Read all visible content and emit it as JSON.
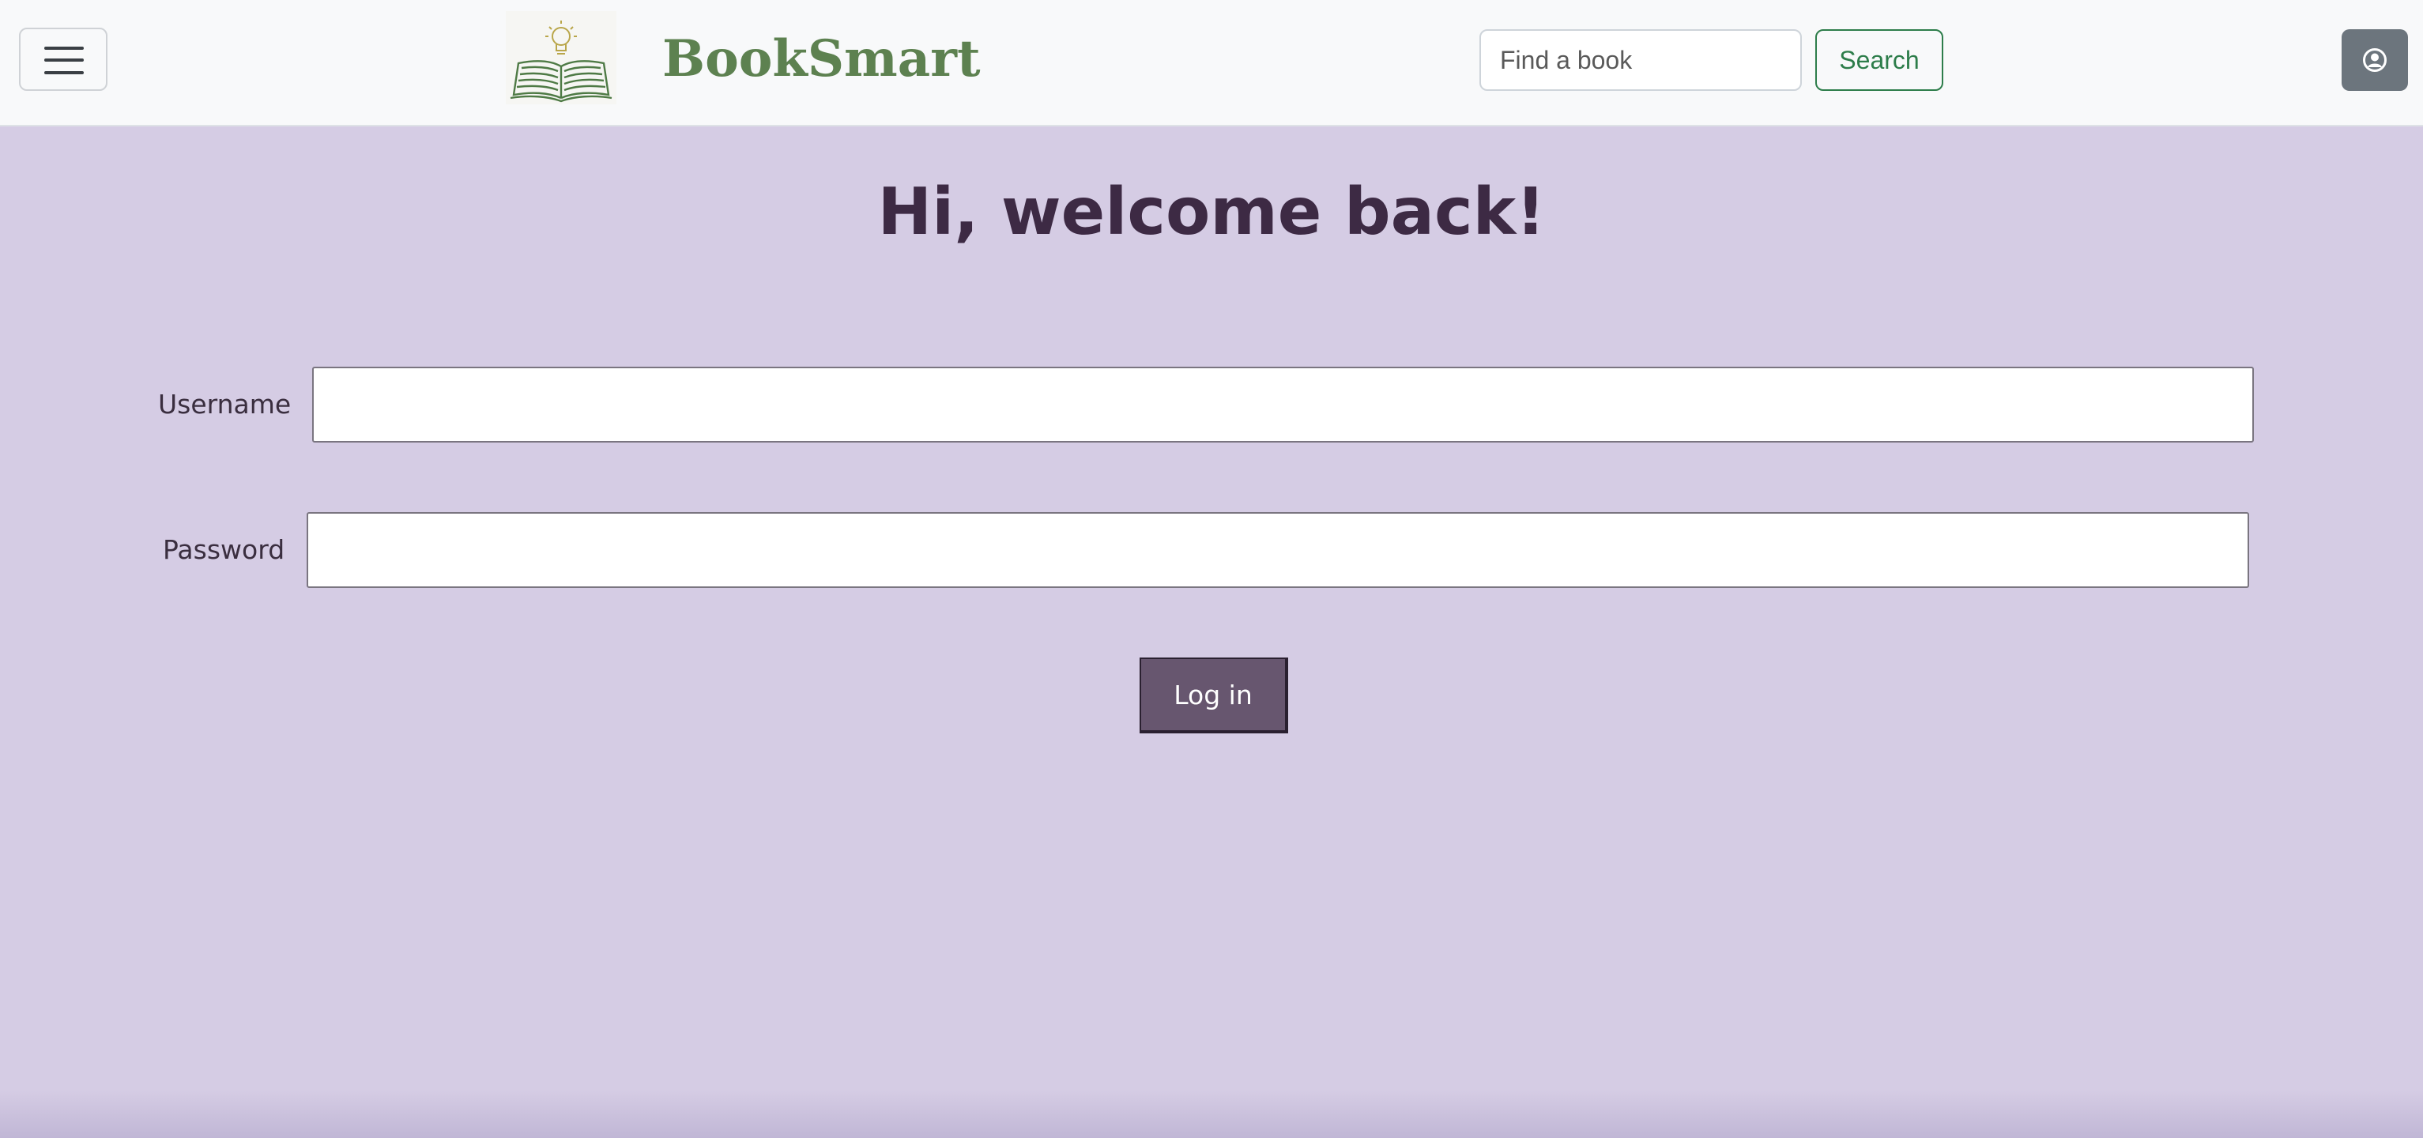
{
  "navbar": {
    "brand": "BookSmart",
    "search": {
      "placeholder": "Find a book",
      "button_label": "Search"
    },
    "icons": {
      "menu": "hamburger-menu-icon",
      "logo": "open-book-lightbulb-logo",
      "user": "user-circle-icon"
    }
  },
  "main": {
    "heading": "Hi, welcome back!",
    "username_label": "Username",
    "password_label": "Password",
    "login_label": "Log in"
  },
  "colors": {
    "page_background": "#d5cce4",
    "brand_green": "#5d8150",
    "search_green": "#2d7d4a",
    "login_button": "#67566f",
    "heading_text": "#3d2a44",
    "user_button": "#6c757d"
  }
}
